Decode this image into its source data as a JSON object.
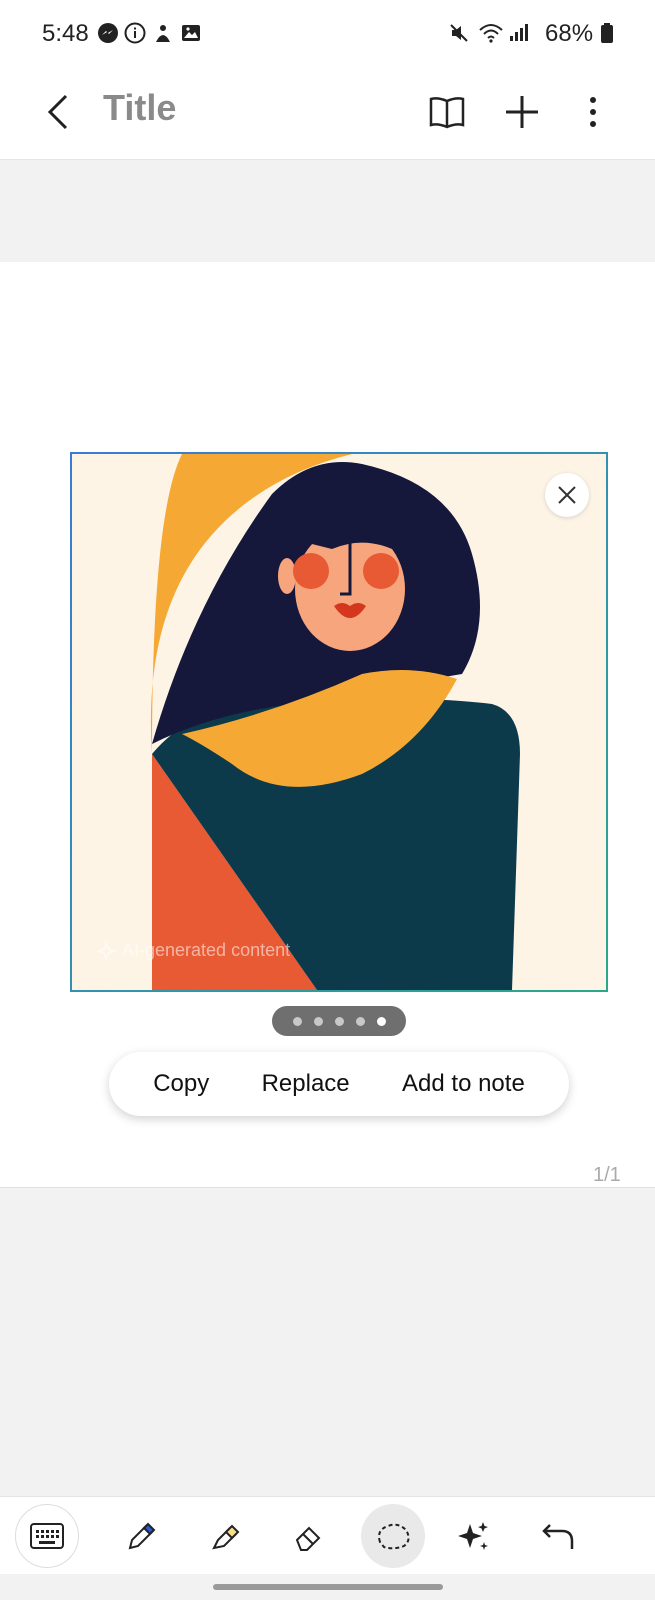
{
  "status_bar": {
    "time": "5:48",
    "battery": "68%"
  },
  "app_bar": {
    "title": "Title"
  },
  "image": {
    "ai_label": "AI-generated content"
  },
  "pager": {
    "count": 5,
    "active_index": 4
  },
  "actions": {
    "copy": "Copy",
    "replace": "Replace",
    "add_to_note": "Add to note"
  },
  "page_indicator": "1/1",
  "toolbar": {
    "tools": [
      "keyboard-icon",
      "pen-icon",
      "highlighter-icon",
      "eraser-icon",
      "lasso-icon",
      "ai-sparkle-icon",
      "undo-icon"
    ]
  },
  "colors": {
    "background": "#f2f2f2",
    "image_bg": "#fdf4e6",
    "hair": "#15183a",
    "scarf": "#f5a934",
    "sweater": "#0d3a4b",
    "orange": "#e85a34",
    "skin": "#f7a57c"
  }
}
